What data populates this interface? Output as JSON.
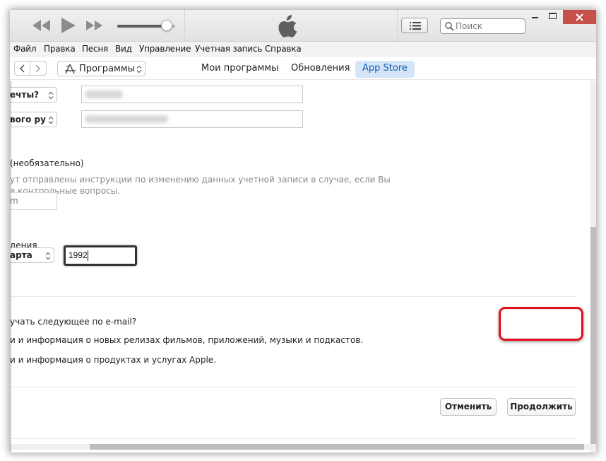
{
  "window": {
    "title_logo": "apple-logo",
    "controls": {
      "minimize": "minimize-icon",
      "maximize": "maximize-icon",
      "close": "close-icon"
    }
  },
  "player": {
    "buttons": [
      "rewind-icon",
      "play-icon",
      "fast-forward-icon"
    ],
    "volume_percent": 85
  },
  "toolbar": {
    "list_view_icon": "list-icon",
    "search_placeholder": "Поиск",
    "search_icon": "search-icon"
  },
  "menu": {
    "items": [
      {
        "label": "Файл"
      },
      {
        "label": "Правка"
      },
      {
        "label": "Песня"
      },
      {
        "label": "Вид"
      },
      {
        "label": "Управление"
      },
      {
        "label": "Учетная запись"
      },
      {
        "label": "Справка"
      }
    ]
  },
  "nav": {
    "back_icon": "chevron-left-icon",
    "forward_icon": "chevron-right-icon",
    "media_kind": "Программы",
    "tabs": [
      {
        "label": "Мои программы",
        "active": false
      },
      {
        "label": "Обновления",
        "active": false
      },
      {
        "label": "App Store",
        "active": true
      }
    ]
  },
  "form": {
    "security_questions": [
      {
        "question": "ечты?",
        "answer_blurred": true
      },
      {
        "question": "вого ру",
        "answer_blurred": true
      }
    ],
    "rescue_email": {
      "label": "(необязательно)",
      "help_line1": "ут отправлены инструкции по изменению данных учетной записи в случае, если Вы",
      "help_line2": "а контрольные вопросы.",
      "placeholder": "m"
    },
    "birthday": {
      "label": "дения.",
      "month": "арта",
      "year": "1992"
    },
    "newsletter": {
      "question": "учать следующее по e-mail?",
      "option1": "и и информация о новых релизах фильмов, приложений, музыки и подкастов.",
      "option2": "и и информация о продуктах и услугах Apple."
    },
    "buttons": {
      "cancel": "Отменить",
      "continue": "Продолжить"
    }
  },
  "colors": {
    "highlight_outline": "#e3101e",
    "active_tab_bg": "#d4e5f7",
    "active_tab_text": "#1a5fb4",
    "close_button": "#c7504b"
  }
}
